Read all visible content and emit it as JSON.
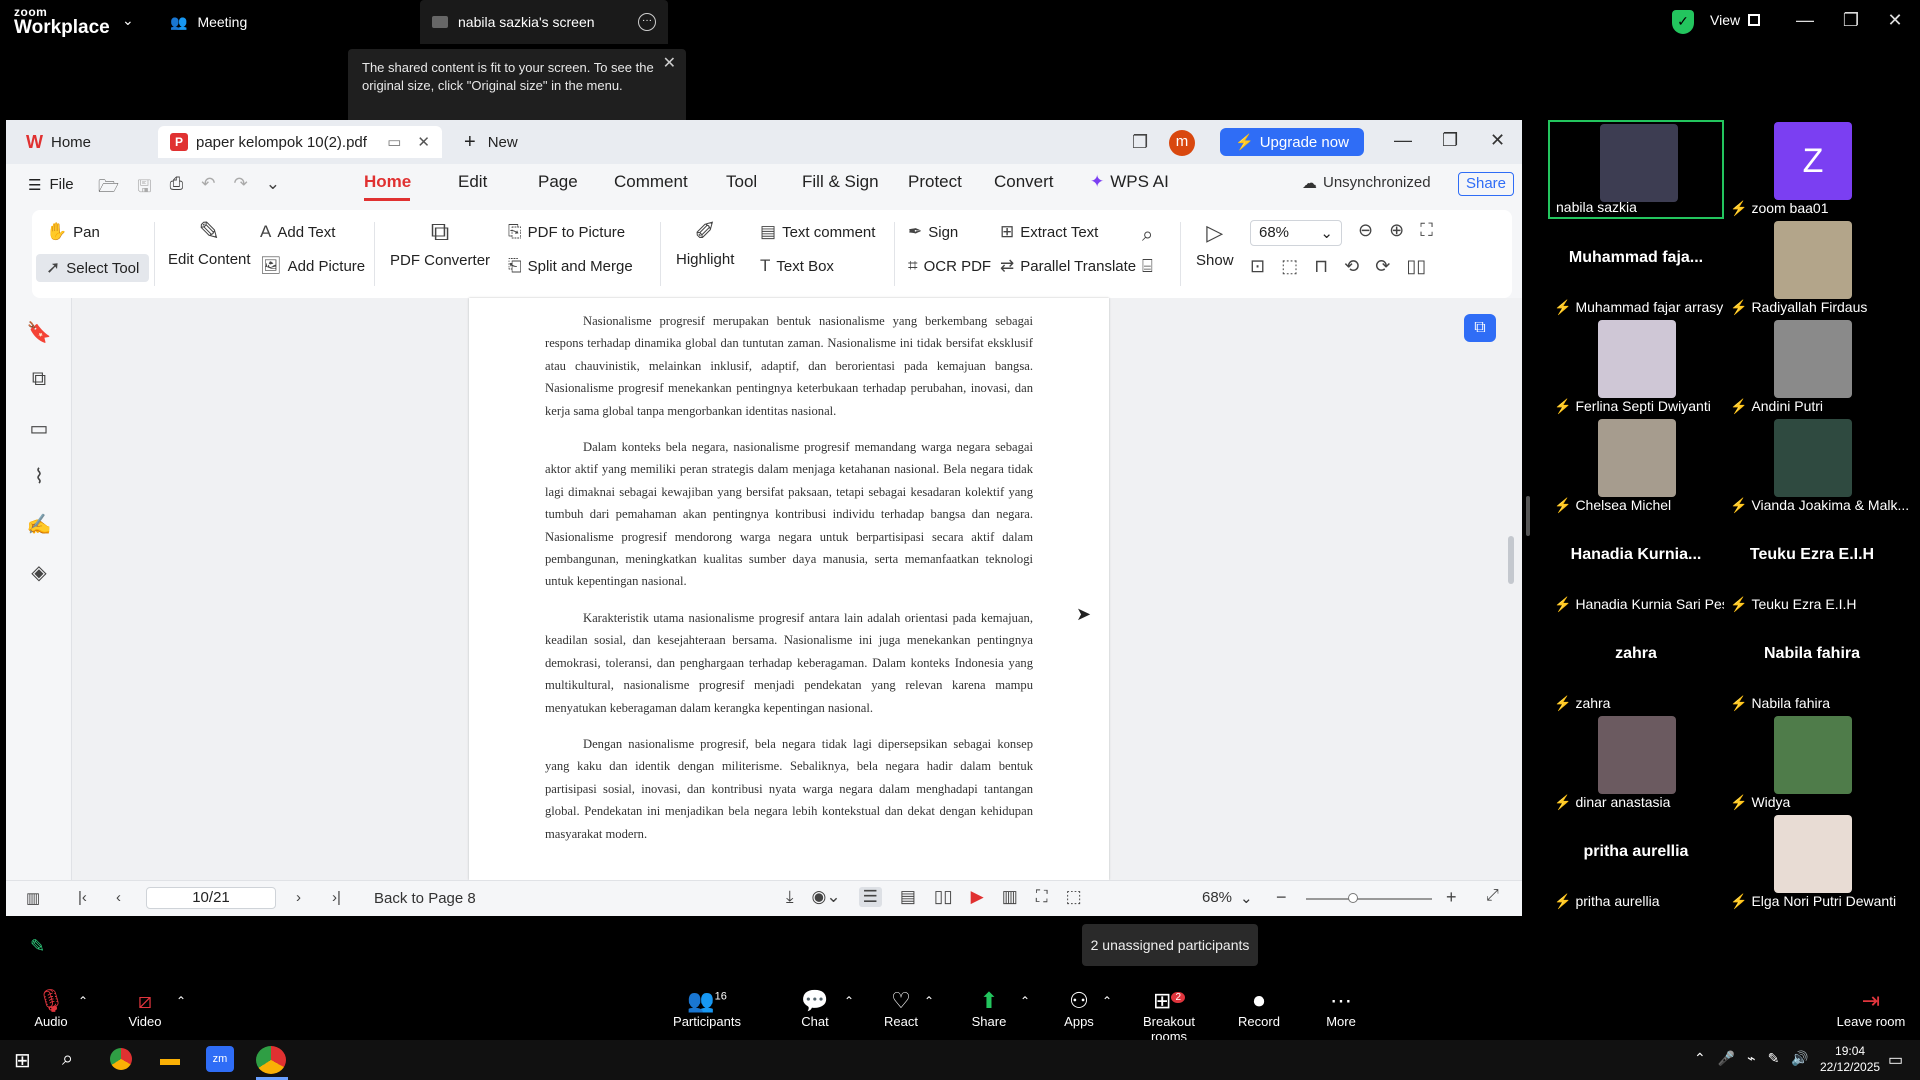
{
  "zoom": {
    "brand_top": "zoom",
    "brand_bottom": "Workplace",
    "meeting_label": "Meeting",
    "screen_label": "nabila sazkia's screen",
    "view_label": "View",
    "tooltip": "The shared content is fit to your screen. To see the original size, click \"Original size\" in the menu.",
    "unassigned": "2 unassigned participants"
  },
  "wps": {
    "home_tab": "Home",
    "file_tab": "paper kelompok 10(2).pdf",
    "new_tab": "New",
    "avatar_letter": "m",
    "upgrade": "Upgrade now",
    "menu": [
      "Home",
      "Edit",
      "Page",
      "Comment",
      "Tool",
      "Fill & Sign",
      "Protect",
      "Convert",
      "WPS AI"
    ],
    "file_menu": "File",
    "sync": "Unsynchronized",
    "share": "Share",
    "ribbon": {
      "pan": "Pan",
      "select_tool": "Select Tool",
      "edit_content": "Edit Content",
      "add_text": "Add Text",
      "add_picture": "Add Picture",
      "pdf_converter": "PDF Converter",
      "pdf_to_picture": "PDF to Picture",
      "split_merge": "Split and Merge",
      "highlight": "Highlight",
      "text_comment": "Text comment",
      "text_box": "Text Box",
      "sign": "Sign",
      "ocr": "OCR PDF",
      "extract_text": "Extract Text",
      "parallel_translate": "Parallel Translate",
      "show": "Show",
      "zoom": "68%"
    },
    "doc_paragraphs": [
      "Nasionalisme progresif merupakan bentuk nasionalisme yang berkembang sebagai respons terhadap dinamika global dan tuntutan zaman. Nasionalisme ini tidak bersifat eksklusif atau chauvinistik, melainkan inklusif, adaptif, dan berorientasi pada kemajuan bangsa. Nasionalisme progresif menekankan pentingnya keterbukaan terhadap perubahan, inovasi, dan kerja sama global tanpa mengorbankan identitas nasional.",
      "Dalam konteks bela negara, nasionalisme progresif memandang warga negara sebagai aktor aktif yang memiliki peran strategis dalam menjaga ketahanan nasional. Bela negara tidak lagi dimaknai sebagai kewajiban yang bersifat paksaan, tetapi sebagai kesadaran kolektif yang tumbuh dari pemahaman akan pentingnya kontribusi individu terhadap bangsa dan negara. Nasionalisme progresif mendorong warga negara untuk berpartisipasi secara aktif dalam pembangunan, meningkatkan kualitas sumber daya manusia, serta memanfaatkan teknologi untuk kepentingan nasional.",
      "Karakteristik utama nasionalisme progresif antara lain adalah orientasi pada kemajuan, keadilan sosial, dan kesejahteraan bersama. Nasionalisme ini juga menekankan pentingnya demokrasi, toleransi, dan penghargaan terhadap keberagaman. Dalam konteks Indonesia yang multikultural, nasionalisme progresif menjadi pendekatan yang relevan karena mampu menyatukan keberagaman dalam kerangka kepentingan nasional.",
      "Dengan nasionalisme progresif, bela negara tidak lagi dipersepsikan sebagai konsep yang kaku dan identik dengan militerisme. Sebaliknya, bela negara hadir dalam bentuk partisipasi sosial, inovasi, dan kontribusi nyata warga negara dalam menghadapi tantangan global. Pendekatan ini menjadikan bela negara lebih kontekstual dan dekat dengan kehidupan masyarakat modern."
    ],
    "status": {
      "page": "10/21",
      "back": "Back to Page 8",
      "zoom": "68%"
    }
  },
  "participants": [
    {
      "name": "nabila sazkia",
      "muted": false,
      "type": "video"
    },
    {
      "name": "zoom baa01",
      "muted": true,
      "type": "letter",
      "letter": "Z"
    },
    {
      "name": "Muhammad fajar arrasyid",
      "muted": true,
      "type": "name",
      "display": "Muhammad  faja..."
    },
    {
      "name": "Radiyallah Firdaus",
      "muted": true,
      "type": "video"
    },
    {
      "name": "Ferlina Septi Dwiyanti",
      "muted": true,
      "type": "photo"
    },
    {
      "name": "Andini Putri",
      "muted": true,
      "type": "photo"
    },
    {
      "name": "Chelsea Michel",
      "muted": true,
      "type": "photo"
    },
    {
      "name": "Vianda Joakima & Malk...",
      "muted": true,
      "type": "video"
    },
    {
      "name": "Hanadia Kurnia Sari Pes...",
      "muted": true,
      "type": "name",
      "display": "Hanadia  Kurnia..."
    },
    {
      "name": "Teuku Ezra E.I.H",
      "muted": true,
      "type": "name",
      "display": "Teuku Ezra E.I.H"
    },
    {
      "name": "zahra",
      "muted": true,
      "type": "name",
      "display": "zahra"
    },
    {
      "name": "Nabila fahira",
      "muted": true,
      "type": "name",
      "display": "Nabila fahira"
    },
    {
      "name": "dinar anastasia",
      "muted": true,
      "type": "photo"
    },
    {
      "name": "Widya",
      "muted": true,
      "type": "photo"
    },
    {
      "name": "pritha aurellia",
      "muted": true,
      "type": "name",
      "display": "pritha aurellia"
    },
    {
      "name": "Elga Nori Putri Dewanti",
      "muted": true,
      "type": "photo"
    }
  ],
  "toolbar": {
    "audio": "Audio",
    "video": "Video",
    "participants": "Participants",
    "participants_count": "16",
    "chat": "Chat",
    "react": "React",
    "share": "Share",
    "apps": "Apps",
    "breakout": "Breakout rooms",
    "breakout_badge": "2",
    "record": "Record",
    "more": "More",
    "leave": "Leave room"
  },
  "taskbar": {
    "time": "19:04",
    "date": "22/12/2025"
  }
}
